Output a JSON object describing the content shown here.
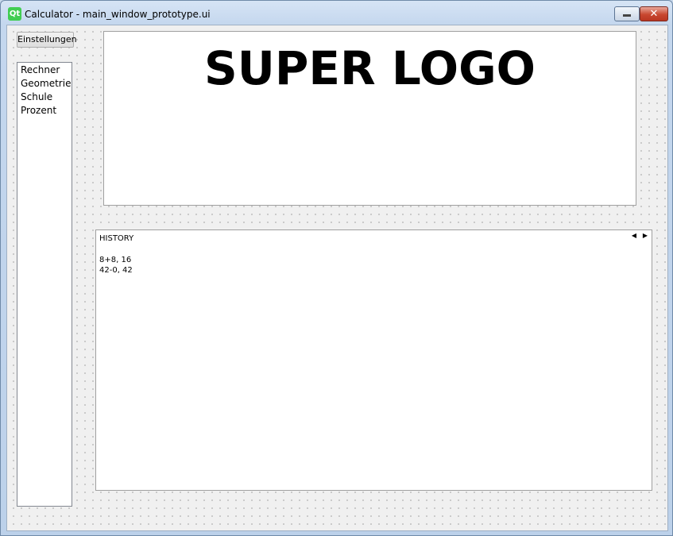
{
  "window": {
    "title": "Calculator - main_window_prototype.ui",
    "app_icon_text": "Qt",
    "minimize_icon": "minimize-icon",
    "close_icon": "close-icon",
    "close_glyph": "✕"
  },
  "toolbar": {
    "settings_label": "Einstellungen"
  },
  "sidebar": {
    "items": [
      {
        "label": "Rechner"
      },
      {
        "label": "Geometrie"
      },
      {
        "label": "Schule"
      },
      {
        "label": "Prozent"
      }
    ]
  },
  "logo": {
    "text": "SUPER LOGO"
  },
  "history": {
    "title": "HISTORY",
    "entries": [
      "8+8, 16",
      "42-0, 42"
    ],
    "left_arrow": "◀",
    "right_arrow": "▶"
  },
  "colors": {
    "qt_green": "#41cd52",
    "close_red": "#c8472f",
    "title_bar_blue": "#c4d7ee"
  }
}
